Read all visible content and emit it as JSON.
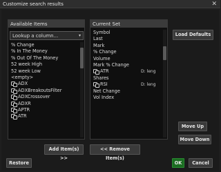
{
  "window": {
    "title": "Customize search results",
    "close_glyph": "✕"
  },
  "available": {
    "header": "Available Items",
    "lookup_placeholder": "Lookup a column...",
    "lookup_caret": "▾",
    "items": [
      {
        "label": "% Change",
        "icon": false
      },
      {
        "label": "% In The Money",
        "icon": false
      },
      {
        "label": "% Out Of The Money",
        "icon": false
      },
      {
        "label": "52 week High",
        "icon": false
      },
      {
        "label": "52 week Low",
        "icon": false
      },
      {
        "label": "<empty>",
        "icon": false
      },
      {
        "label": "ADX",
        "icon": true
      },
      {
        "label": "ADXBreakoutsFilter",
        "icon": true
      },
      {
        "label": "ADXCrossover",
        "icon": true
      },
      {
        "label": "ADXR",
        "icon": true
      },
      {
        "label": "APTR",
        "icon": true
      },
      {
        "label": "ATR",
        "icon": true
      }
    ]
  },
  "current": {
    "header": "Current Set",
    "items": [
      {
        "label": "Symbol",
        "icon": false,
        "extra": ""
      },
      {
        "label": "Last",
        "icon": false,
        "extra": ""
      },
      {
        "label": "Mark",
        "icon": false,
        "extra": ""
      },
      {
        "label": "% Change",
        "icon": false,
        "extra": ""
      },
      {
        "label": "Volume",
        "icon": false,
        "extra": ""
      },
      {
        "label": "Mark % Change",
        "icon": false,
        "extra": ""
      },
      {
        "label": "ATR",
        "icon": true,
        "extra": "D: leng"
      },
      {
        "label": "Shares",
        "icon": false,
        "extra": ""
      },
      {
        "label": "RSI",
        "icon": true,
        "extra": "D: leng"
      },
      {
        "label": "Net Change",
        "icon": false,
        "extra": ""
      },
      {
        "label": "Vol Index",
        "icon": false,
        "extra": ""
      }
    ]
  },
  "buttons": {
    "load_defaults": "Load Defaults",
    "move_up": "Move Up",
    "move_down": "Move Down",
    "add_items": "Add Item(s) >>",
    "remove_items": "<< Remove Item(s)",
    "restore": "Restore",
    "ok": "OK",
    "cancel": "Cancel"
  },
  "colors": {
    "ok_green": "#1b6d21",
    "background": "#1b1b1b",
    "panel_header": "#3b3b3b"
  }
}
